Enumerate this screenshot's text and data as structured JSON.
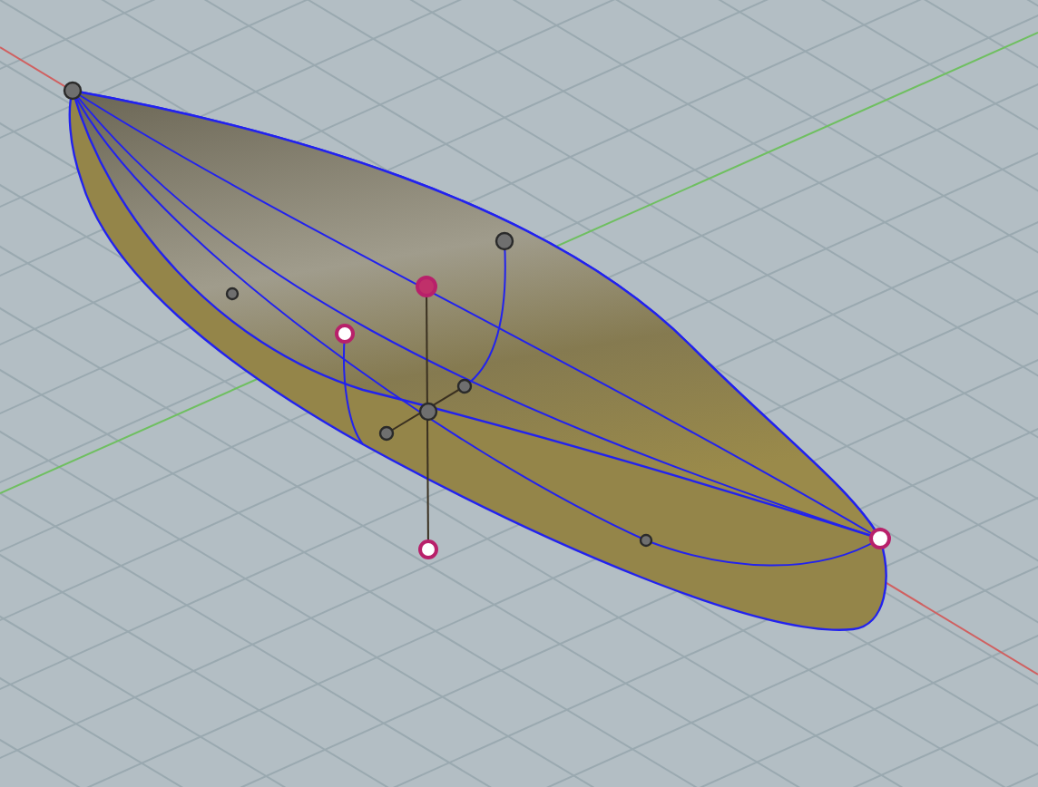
{
  "viewport": {
    "control_points": [
      {
        "selected": false
      },
      {
        "selected": false
      },
      {
        "selected": true
      },
      {
        "selected": true
      },
      {
        "selected": false
      },
      {
        "selected": false
      },
      {
        "selected": false
      },
      {
        "selected": true
      },
      {
        "selected": true
      },
      {
        "selected": false
      },
      {
        "selected": false
      }
    ]
  }
}
